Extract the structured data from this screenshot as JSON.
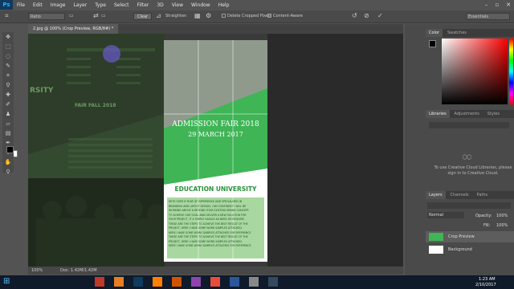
{
  "app": {
    "logo": "Ps"
  },
  "menu": [
    "File",
    "Edit",
    "Image",
    "Layer",
    "Type",
    "Select",
    "Filter",
    "3D",
    "View",
    "Window",
    "Help"
  ],
  "window_controls": [
    "–",
    "▫",
    "✕"
  ],
  "options": {
    "ratio": "Ratio",
    "clear": "Clear",
    "straighten": "Straighten",
    "delete_cropped": "Delete Cropped Pixels",
    "content_aware": "Content-Aware",
    "workspace": "Essentials"
  },
  "document": {
    "tab": "2.jpg @ 100% (Crop Preview, RGB/8#) *"
  },
  "poster": {
    "title": "ADMISSION FAIR 2018",
    "date": "29 MARCH 2017",
    "band": "EDUCATION UNIVERSITY",
    "body": [
      "WITH OVER 8 YEAR OF EXPERIENCE AND SPECIALIZED IN",
      "BRANDING AND LAYOUT DESIGN, I AM CONFIDENT I WILL BE",
      "WORKING ABOVE & BEYOND YOUR EXISTING BRAND CONCEPT.",
      "TO ACHIEVE OUR GOAL AND DELIVER A NEW SOLUTION FOR",
      "YOUR PROJECT, IT A SIMPLE HASSLE AS NEED OR REQUIRE.",
      "THESE ARE THE STEPS TO ACHIEVE THE BEST RESULT OF THE",
      "PROJECT, HERE I HAVE SOME WORK SAMPLES ATTACHED.",
      "HERE I HAVE SOME WORK SAMPLES ATTACHED FOR REFERENCE",
      "THESE ARE THE STEPS TO ACHIEVE THE BEST RESULT OF THE",
      "PROJECT, HERE I HAVE SOME WORK SAMPLES ATTACHED.",
      "HERE I HAVE SOME WORK SAMPLES ATTACHED FOR REFERENCE"
    ]
  },
  "left_image": {
    "heading": "RSITY",
    "fair": "FAIR FALL 2018"
  },
  "status": {
    "zoom": "100%",
    "doc": "Doc: 1.42M/1.42M"
  },
  "panels": {
    "color_tabs": [
      "Color",
      "Swatches"
    ],
    "lib_tabs": [
      "Libraries",
      "Adjustments",
      "Styles"
    ],
    "cc_message": "To use Creative Cloud Libraries, please sign in to Creative Cloud.",
    "layers_tabs": [
      "Layers",
      "Channels",
      "Paths"
    ],
    "blend": "Normal",
    "opacity_label": "Opacity:",
    "opacity": "100%",
    "fill_label": "Fill:",
    "fill": "100%",
    "layers": [
      "Crop Preview",
      "Background"
    ]
  },
  "taskbar": {
    "time": "1:23 AM",
    "date": "2/10/2017"
  },
  "colors": {
    "accent": "#3fb556",
    "cursor": "#6a5acd",
    "ps_blue": "#31a8ff"
  }
}
